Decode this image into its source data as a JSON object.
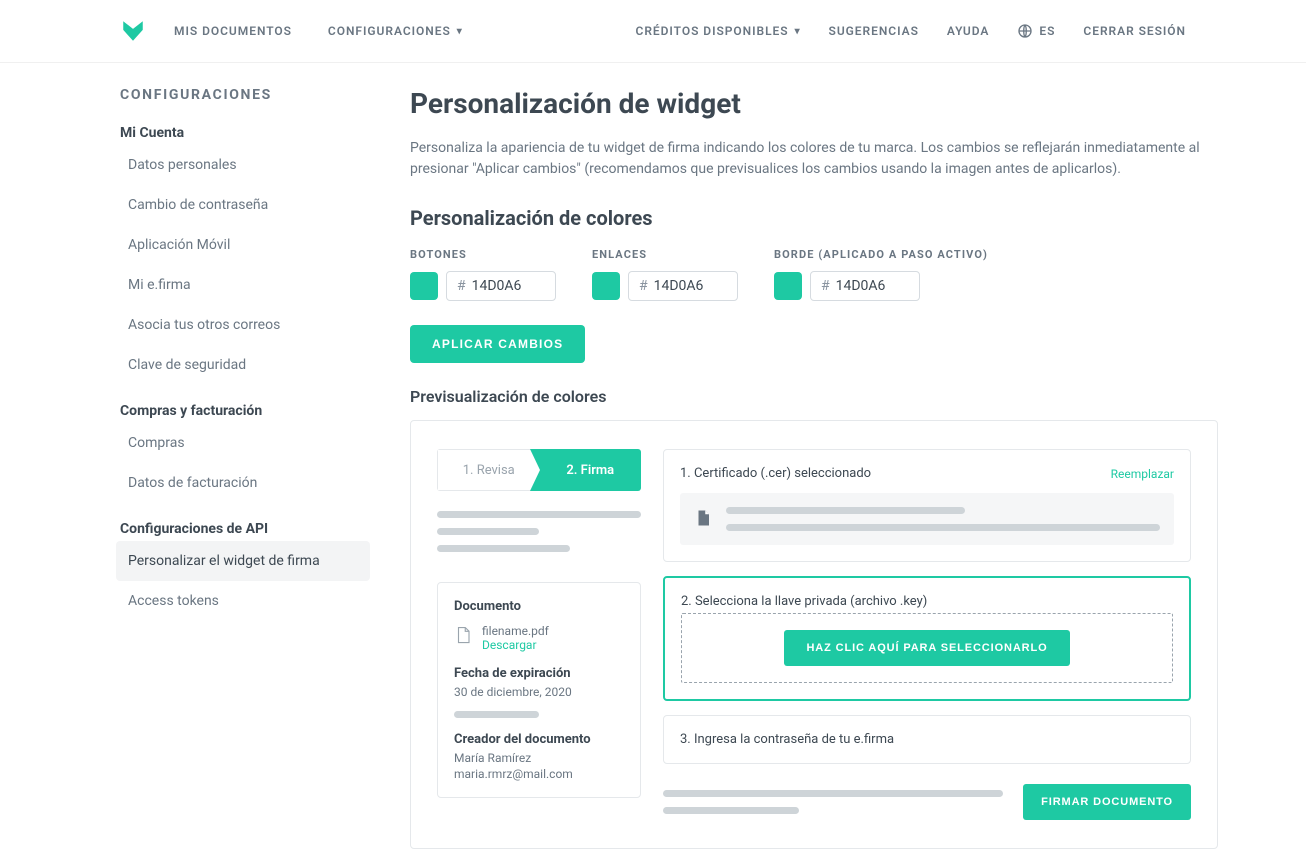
{
  "nav": {
    "left": [
      "MIS DOCUMENTOS",
      "CONFIGURACIONES"
    ],
    "right": [
      "CRÉDITOS DISPONIBLES",
      "SUGERENCIAS",
      "AYUDA"
    ],
    "lang": "ES",
    "logout": "CERRAR SESIÓN"
  },
  "sidebar": {
    "title": "CONFIGURACIONES",
    "sections": [
      {
        "label": "Mi Cuenta",
        "items": [
          "Datos personales",
          "Cambio de contraseña",
          "Aplicación Móvil",
          "Mi e.firma",
          "Asocia tus otros correos",
          "Clave de seguridad"
        ]
      },
      {
        "label": "Compras y facturación",
        "items": [
          "Compras",
          "Datos de facturación"
        ]
      },
      {
        "label": "Configuraciones de API",
        "items": [
          "Personalizar el widget de firma",
          "Access tokens"
        ]
      }
    ],
    "active": "Personalizar el widget de firma"
  },
  "page": {
    "title": "Personalización de widget",
    "description": "Personaliza la apariencia de tu widget de firma indicando los colores de tu marca. Los cambios se reflejarán inmediatamente al presionar \"Aplicar cambios\" (recomendamos que previsualices los cambios usando la imagen antes de aplicarlos).",
    "colors_title": "Personalización de colores",
    "color_fields": [
      {
        "label": "BOTONES",
        "value": "14D0A6",
        "swatch": "#1ec9a3"
      },
      {
        "label": "ENLACES",
        "value": "14D0A6",
        "swatch": "#1ec9a3"
      },
      {
        "label": "BORDE (APLICADO A PASO ACTIVO)",
        "value": "14D0A6",
        "swatch": "#1ec9a3"
      }
    ],
    "apply_button": "APLICAR CAMBIOS",
    "preview_label": "Previsualización de colores"
  },
  "preview": {
    "steps": {
      "inactive": "1. Revisa",
      "active": "2. Firma"
    },
    "doc_card": {
      "title": "Documento",
      "filename": "filename.pdf",
      "download": "Descargar",
      "exp_label": "Fecha de expiración",
      "exp_value": "30 de diciembre, 2020",
      "creator_label": "Creador del documento",
      "creator_name": "María Ramírez",
      "creator_email": "maria.rmrz@mail.com"
    },
    "step1": {
      "title": "1. Certificado (.cer) seleccionado",
      "action": "Reemplazar"
    },
    "step2": {
      "title": "2. Selecciona la llave privada (archivo .key)",
      "button": "HAZ CLIC AQUÍ PARA SELECCIONARLO"
    },
    "step3": {
      "title": "3. Ingresa la contraseña de tu e.firma"
    },
    "sign_button": "FIRMAR DOCUMENTO"
  }
}
